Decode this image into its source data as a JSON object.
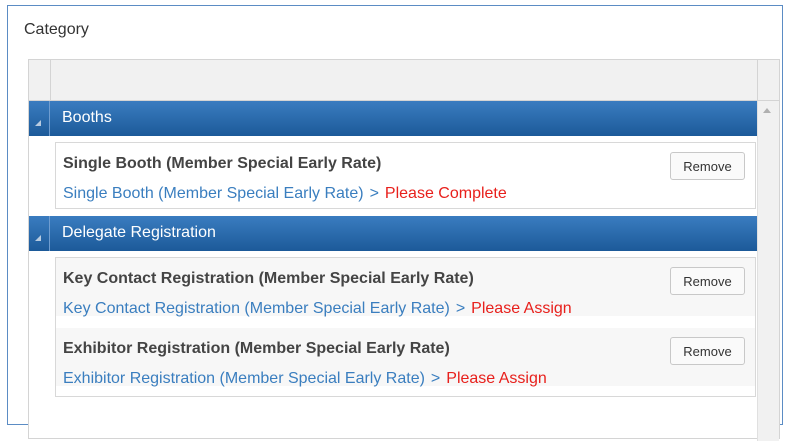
{
  "panel": {
    "title": "Category"
  },
  "groups": [
    {
      "name": "Booths",
      "items": [
        {
          "title": "Single Booth (Member Special Early Rate)",
          "link": "Single Booth (Member Special Early Rate)",
          "separator": ">",
          "status": "Please Complete",
          "button": "Remove"
        }
      ]
    },
    {
      "name": "Delegate Registration",
      "items": [
        {
          "title": "Key Contact Registration (Member Special Early Rate)",
          "link": "Key Contact Registration (Member Special Early Rate)",
          "separator": ">",
          "status": "Please Assign",
          "button": "Remove"
        },
        {
          "title": "Exhibitor Registration (Member Special Early Rate)",
          "link": "Exhibitor Registration (Member Special Early Rate)",
          "separator": ">",
          "status": "Please Assign",
          "button": "Remove"
        }
      ]
    }
  ],
  "colors": {
    "header_blue": "#1c5a99",
    "link_blue": "#3a7ebf",
    "status_red": "#e8201c"
  }
}
